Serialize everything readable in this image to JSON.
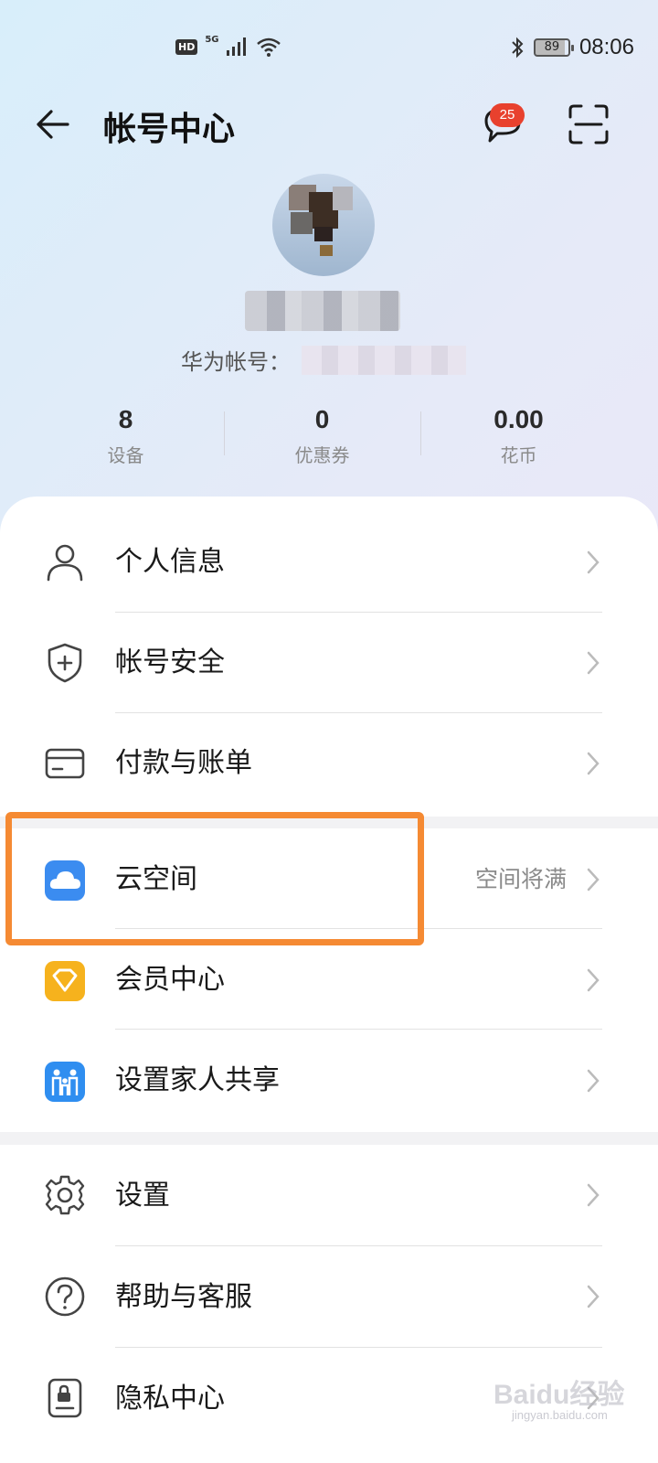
{
  "status_bar": {
    "hd": "HD",
    "network": "5G",
    "battery": "89",
    "time": "08:06"
  },
  "header": {
    "title": "帐号中心",
    "message_badge": "25"
  },
  "profile": {
    "account_label": "华为帐号："
  },
  "stats": [
    {
      "value": "8",
      "label": "设备"
    },
    {
      "value": "0",
      "label": "优惠券"
    },
    {
      "value": "0.00",
      "label": "花币"
    }
  ],
  "menu": {
    "personal_info": "个人信息",
    "account_security": "帐号安全",
    "payment_billing": "付款与账单",
    "cloud_space": "云空间",
    "cloud_space_status": "空间将满",
    "member_center": "会员中心",
    "family_sharing": "设置家人共享",
    "settings": "设置",
    "help_service": "帮助与客服",
    "privacy_center": "隐私中心"
  },
  "watermark": {
    "text": "Baidu经验",
    "sub": "jingyan.baidu.com"
  },
  "colors": {
    "highlight": "#f58a33",
    "badge": "#e8412e",
    "cloud_icon": "#3b8cf0",
    "member_icon": "#f6b21d",
    "family_icon": "#2f8ef0"
  }
}
